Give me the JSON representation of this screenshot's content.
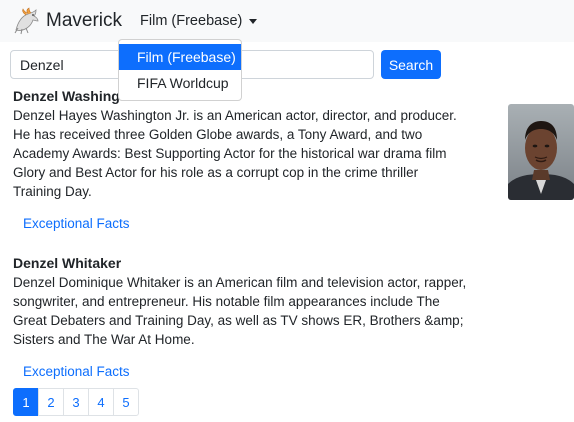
{
  "navbar": {
    "brand_name": "Maverick",
    "dataset_selected": "Film (Freebase)",
    "dataset_options": [
      "Film (Freebase)",
      "FIFA Worldcup"
    ]
  },
  "search": {
    "value": "Denzel",
    "button_label": "Search"
  },
  "results": [
    {
      "name": "Denzel Washington",
      "description": "Denzel Hayes Washington Jr. is an American actor, director, and producer. He has received three Golden Globe awards, a Tony Award, and two Academy Awards: Best Supporting Actor for the historical war drama film Glory and Best Actor for his role as a corrupt cop in the crime thriller Training Day.",
      "link_label": "Exceptional Facts"
    },
    {
      "name": "Denzel Whitaker",
      "description": "Denzel Dominique Whitaker is an American film and television actor, rapper, songwriter, and entrepreneur. His notable film appearances include The Great Debaters and Training Day, as well as TV shows ER, Brothers &amp; Sisters and The War At Home.",
      "link_label": "Exceptional Facts"
    }
  ],
  "pagination": {
    "pages": [
      "1",
      "2",
      "3",
      "4",
      "5"
    ],
    "active": "1"
  },
  "colors": {
    "accent": "#0d6efd",
    "navbar_bg": "#f8f9fa"
  }
}
